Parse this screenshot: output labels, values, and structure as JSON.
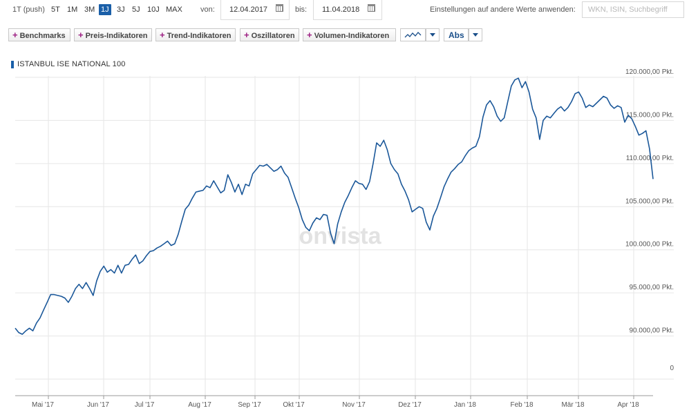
{
  "toolbar": {
    "range_label": "1T (push)",
    "ranges": [
      "5T",
      "1M",
      "3M",
      "1J",
      "3J",
      "5J",
      "10J",
      "MAX"
    ],
    "active_range": "1J",
    "from_label": "von:",
    "from_date": "12.04.2017",
    "to_label": "bis:",
    "to_date": "11.04.2018",
    "settings_label": "Einstellungen auf andere Werte anwenden:",
    "search_placeholder": "WKN, ISIN, Suchbegriff"
  },
  "indicators": {
    "buttons": [
      "Benchmarks",
      "Preis-Indikatoren",
      "Trend-Indikatoren",
      "Oszillatoren",
      "Volumen-Indikatoren"
    ],
    "scale_mode": "Abs"
  },
  "watermark": "onvista",
  "colors": {
    "line": "#1a5799",
    "accent": "#1a5fa8",
    "plus": "#9c1e82",
    "grid": "#e6e6e6"
  },
  "chart_data": {
    "type": "line",
    "title": "ISTANBUL ISE NATIONAL 100",
    "ylim": [
      85000,
      120000
    ],
    "y_ticks": [
      {
        "value": 120000,
        "label": "120.000,00 Pkt."
      },
      {
        "value": 115000,
        "label": "115.000,00 Pkt."
      },
      {
        "value": 110000,
        "label": "110.000,00 Pkt."
      },
      {
        "value": 105000,
        "label": "105.000,00 Pkt."
      },
      {
        "value": 100000,
        "label": "100.000,00 Pkt."
      },
      {
        "value": 95000,
        "label": "95.000,00 Pkt."
      },
      {
        "value": 90000,
        "label": "90.000,00 Pkt."
      }
    ],
    "extra_tick": "0",
    "x_ticks": [
      "Mai '17",
      "Jun '17",
      "Jul '17",
      "Aug '17",
      "Sep '17",
      "Okt '17",
      "Nov '17",
      "Dez '17",
      "Jan '18",
      "Feb '18",
      "Mär '18",
      "Apr '18"
    ],
    "grid": true,
    "series": [
      {
        "values": [
          [
            0,
            90900
          ],
          [
            2,
            90400
          ],
          [
            4,
            90200
          ],
          [
            6,
            90600
          ],
          [
            8,
            90900
          ],
          [
            10,
            90600
          ],
          [
            12,
            91500
          ],
          [
            14,
            92100
          ],
          [
            16,
            93000
          ],
          [
            18,
            93900
          ],
          [
            20,
            94800
          ],
          [
            22,
            94800
          ],
          [
            24,
            94700
          ],
          [
            26,
            94600
          ],
          [
            28,
            94400
          ],
          [
            30,
            93900
          ],
          [
            32,
            94600
          ],
          [
            34,
            95500
          ],
          [
            36,
            96000
          ],
          [
            38,
            95500
          ],
          [
            40,
            96200
          ],
          [
            42,
            95500
          ],
          [
            44,
            94700
          ],
          [
            46,
            96400
          ],
          [
            48,
            97500
          ],
          [
            50,
            98100
          ],
          [
            52,
            97400
          ],
          [
            54,
            97700
          ],
          [
            56,
            97300
          ],
          [
            58,
            98200
          ],
          [
            60,
            97300
          ],
          [
            62,
            98200
          ],
          [
            64,
            98300
          ],
          [
            66,
            98900
          ],
          [
            68,
            99400
          ],
          [
            70,
            98400
          ],
          [
            72,
            98700
          ],
          [
            74,
            99300
          ],
          [
            76,
            99800
          ],
          [
            78,
            99900
          ],
          [
            80,
            100200
          ],
          [
            82,
            100400
          ],
          [
            84,
            100700
          ],
          [
            86,
            101000
          ],
          [
            88,
            100500
          ],
          [
            90,
            100700
          ],
          [
            92,
            101800
          ],
          [
            94,
            103300
          ],
          [
            96,
            104700
          ],
          [
            98,
            105200
          ],
          [
            100,
            106000
          ],
          [
            102,
            106700
          ],
          [
            104,
            106800
          ],
          [
            106,
            106900
          ],
          [
            108,
            107400
          ],
          [
            110,
            107200
          ],
          [
            112,
            108000
          ],
          [
            114,
            107300
          ],
          [
            116,
            106600
          ],
          [
            118,
            106900
          ],
          [
            120,
            108700
          ],
          [
            122,
            107800
          ],
          [
            124,
            106700
          ],
          [
            126,
            107600
          ],
          [
            128,
            106400
          ],
          [
            130,
            107600
          ],
          [
            132,
            107400
          ],
          [
            134,
            108800
          ],
          [
            136,
            109300
          ],
          [
            138,
            109800
          ],
          [
            140,
            109700
          ],
          [
            142,
            109900
          ],
          [
            144,
            109500
          ],
          [
            146,
            109100
          ],
          [
            148,
            109300
          ],
          [
            150,
            109700
          ],
          [
            152,
            108900
          ],
          [
            154,
            108400
          ],
          [
            156,
            107200
          ],
          [
            158,
            106000
          ],
          [
            160,
            104900
          ],
          [
            162,
            103500
          ],
          [
            164,
            102600
          ],
          [
            166,
            102200
          ],
          [
            168,
            103100
          ],
          [
            170,
            103700
          ],
          [
            172,
            103500
          ],
          [
            174,
            104100
          ],
          [
            176,
            104000
          ],
          [
            178,
            101900
          ],
          [
            180,
            100700
          ],
          [
            182,
            103000
          ],
          [
            184,
            104400
          ],
          [
            186,
            105500
          ],
          [
            188,
            106300
          ],
          [
            190,
            107200
          ],
          [
            192,
            108000
          ],
          [
            194,
            107700
          ],
          [
            196,
            107600
          ],
          [
            198,
            107000
          ],
          [
            200,
            107900
          ],
          [
            202,
            110000
          ],
          [
            204,
            112400
          ],
          [
            206,
            112000
          ],
          [
            208,
            112700
          ],
          [
            210,
            111600
          ],
          [
            212,
            110000
          ],
          [
            214,
            109300
          ],
          [
            216,
            108800
          ],
          [
            218,
            107600
          ],
          [
            220,
            106800
          ],
          [
            222,
            105800
          ],
          [
            224,
            104400
          ],
          [
            226,
            104700
          ],
          [
            228,
            105000
          ],
          [
            230,
            104800
          ],
          [
            232,
            103200
          ],
          [
            234,
            102300
          ],
          [
            236,
            103900
          ],
          [
            238,
            104800
          ],
          [
            240,
            106000
          ],
          [
            242,
            107300
          ],
          [
            244,
            108200
          ],
          [
            246,
            109000
          ],
          [
            248,
            109400
          ],
          [
            250,
            109900
          ],
          [
            252,
            110200
          ],
          [
            254,
            110900
          ],
          [
            256,
            111500
          ],
          [
            258,
            111800
          ],
          [
            260,
            112000
          ],
          [
            262,
            113100
          ],
          [
            264,
            115400
          ],
          [
            266,
            116800
          ],
          [
            268,
            117300
          ],
          [
            270,
            116600
          ],
          [
            272,
            115500
          ],
          [
            274,
            114900
          ],
          [
            276,
            115300
          ],
          [
            278,
            117200
          ],
          [
            280,
            119000
          ],
          [
            282,
            119700
          ],
          [
            284,
            119900
          ],
          [
            286,
            118800
          ],
          [
            288,
            119500
          ],
          [
            290,
            118300
          ],
          [
            292,
            116300
          ],
          [
            294,
            115300
          ],
          [
            296,
            112800
          ],
          [
            298,
            115000
          ],
          [
            300,
            115500
          ],
          [
            302,
            115300
          ],
          [
            304,
            115800
          ],
          [
            306,
            116300
          ],
          [
            308,
            116600
          ],
          [
            310,
            116100
          ],
          [
            312,
            116500
          ],
          [
            314,
            117200
          ],
          [
            316,
            118100
          ],
          [
            318,
            118300
          ],
          [
            320,
            117600
          ],
          [
            322,
            116500
          ],
          [
            324,
            116800
          ],
          [
            326,
            116600
          ],
          [
            328,
            117000
          ],
          [
            330,
            117400
          ],
          [
            332,
            117800
          ],
          [
            334,
            117600
          ],
          [
            336,
            116800
          ],
          [
            338,
            116400
          ],
          [
            340,
            116700
          ],
          [
            342,
            116500
          ],
          [
            344,
            114800
          ],
          [
            346,
            115600
          ],
          [
            348,
            115200
          ],
          [
            350,
            114300
          ],
          [
            352,
            113300
          ],
          [
            354,
            113500
          ],
          [
            356,
            113800
          ],
          [
            358,
            111700
          ],
          [
            360,
            108200
          ]
        ]
      }
    ]
  }
}
